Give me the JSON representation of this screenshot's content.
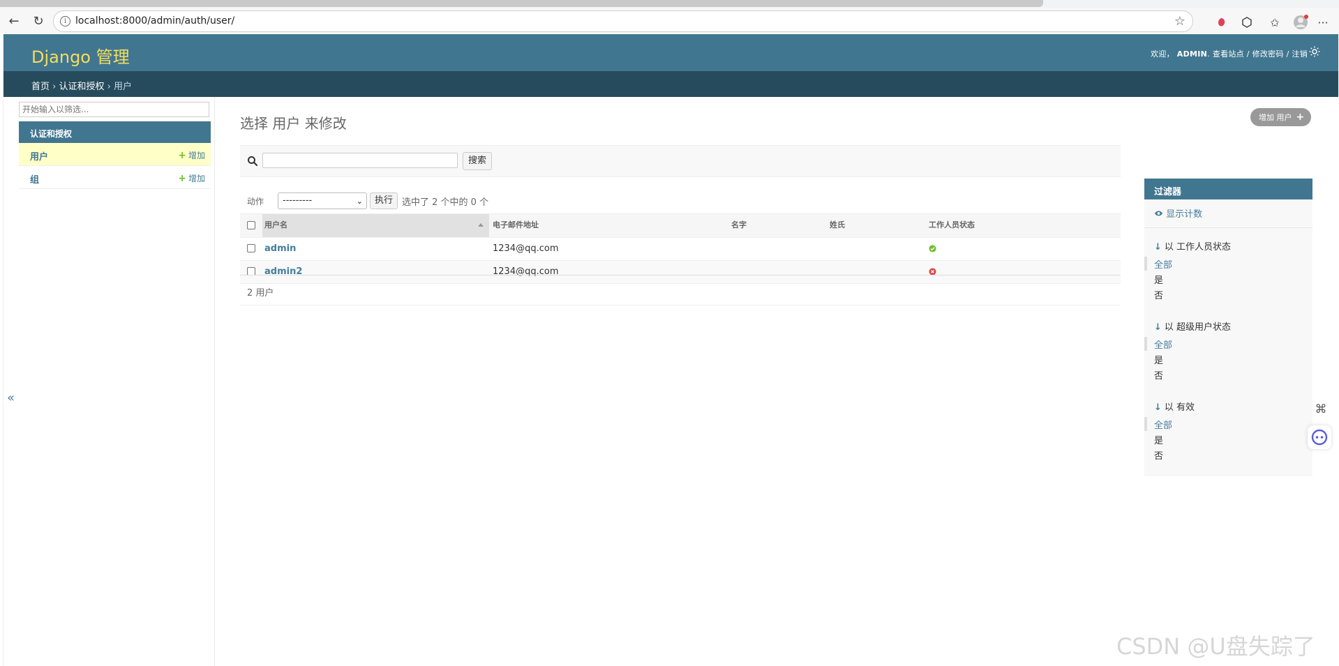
{
  "browser": {
    "url": "localhost:8000/admin/auth/user/"
  },
  "header": {
    "brand": "Django 管理",
    "welcome": "欢迎，",
    "username": "ADMIN",
    "view_site": "查看站点",
    "change_password": "修改密码",
    "logout": "注销",
    "separator": " / "
  },
  "breadcrumbs": {
    "home": "首页",
    "app": "认证和授权",
    "current": "用户",
    "sep": " › "
  },
  "sidebar": {
    "filter_placeholder": "开始输入以筛选...",
    "app_name": "认证和授权",
    "models": [
      {
        "name": "用户",
        "add_label": "增加",
        "current": true
      },
      {
        "name": "组",
        "add_label": "增加",
        "current": false
      }
    ],
    "collapse_label": "«"
  },
  "main": {
    "title": "选择 用户 来修改",
    "add_button_label": "增加 用户",
    "search_button_label": "搜索",
    "actions_label": "动作",
    "action_selected": "---------",
    "run_button_label": "执行",
    "selection_counter": "选中了 2 个中的 0 个",
    "columns": [
      "用户名",
      "电子邮件地址",
      "名字",
      "姓氏",
      "工作人员状态"
    ],
    "rows": [
      {
        "username": "admin",
        "email": "1234@qq.com",
        "first_name": "",
        "last_name": "",
        "is_staff": true
      },
      {
        "username": "admin2",
        "email": "1234@qq.com",
        "first_name": "",
        "last_name": "",
        "is_staff": false
      }
    ],
    "paginator": "2 用户"
  },
  "filter": {
    "title": "过滤器",
    "show_counts": "显示计数",
    "groups": [
      {
        "title": "以 工作人员状态",
        "options": [
          "全部",
          "是",
          "否"
        ]
      },
      {
        "title": "以 超级用户状态",
        "options": [
          "全部",
          "是",
          "否"
        ]
      },
      {
        "title": "以 有效",
        "options": [
          "全部",
          "是",
          "否"
        ]
      }
    ]
  },
  "watermark": "CSDN @U盘失踪了",
  "colors": {
    "header_bg": "#417690",
    "breadcrumb_bg": "#264b5d",
    "brand": "#f5dd5d",
    "link": "#447e9b",
    "current_model_bg": "#ffffc8",
    "status_yes": "#70bf2b",
    "status_no": "#dd4646"
  },
  "icons": {
    "back": "arrow-left-icon",
    "reload": "reload-icon",
    "info": "info-icon",
    "bookmark": "star-icon",
    "theme": "sun-icon",
    "search": "magnifier-icon",
    "add": "plus-icon",
    "eye": "eye-icon",
    "status_yes": "check-circle-icon",
    "status_no": "x-circle-icon"
  }
}
